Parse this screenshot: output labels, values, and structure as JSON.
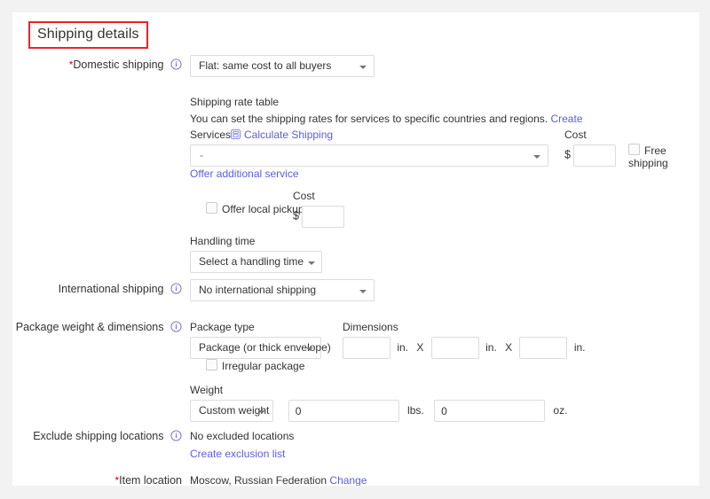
{
  "section": {
    "title": "Shipping details",
    "highlight_color": "#e8242a"
  },
  "link_color": "#5c5ce0",
  "rows": {
    "domestic_shipping": {
      "label": "Domestic shipping",
      "required_marker": "*",
      "info_icon": "info-icon",
      "select_value": "Flat: same cost to all buyers"
    },
    "rate_table": {
      "title": "Shipping rate table",
      "description": "You can set the shipping rates for services to specific countries and regions.",
      "create_link": "Create"
    },
    "services": {
      "label": "Services",
      "calculate_link": "Calculate Shipping",
      "calculate_icon": "calculator-icon",
      "select_value": "-",
      "cost_label": "Cost",
      "currency_symbol": "$",
      "cost_value": "",
      "free_shipping_label": "Free shipping",
      "free_shipping_checked": false
    },
    "offer_additional_service": {
      "link": "Offer additional service"
    },
    "local_pickup": {
      "checkbox_label": "Offer local pickup",
      "checked": false,
      "cost_label": "Cost",
      "currency_symbol": "$",
      "cost_value": ""
    },
    "handling_time": {
      "label": "Handling time",
      "select_value": "Select a handling time"
    },
    "international_shipping": {
      "label": "International shipping",
      "info_icon": "info-icon",
      "select_value": "No international shipping"
    },
    "package": {
      "label": "Package weight & dimensions",
      "info_icon": "info-icon",
      "package_type_label": "Package type",
      "package_type_value": "Package (or thick envelope)",
      "dimensions_label": "Dimensions",
      "dim_length": "",
      "dim_width": "",
      "dim_height": "",
      "unit": "in.",
      "separator": "X",
      "irregular_label": "Irregular package",
      "irregular_checked": false
    },
    "weight": {
      "label": "Weight",
      "unit_select_value": "Custom weight",
      "lbs_value": "0",
      "lbs_unit": "lbs.",
      "oz_value": "0",
      "oz_unit": "oz."
    },
    "exclude_locations": {
      "label": "Exclude shipping locations",
      "info_icon": "info-icon",
      "status_text": "No excluded locations",
      "create_link": "Create exclusion list"
    },
    "item_location": {
      "label": "Item location",
      "required_marker": "*",
      "value": "Moscow, Russian Federation",
      "change_link": "Change"
    }
  }
}
